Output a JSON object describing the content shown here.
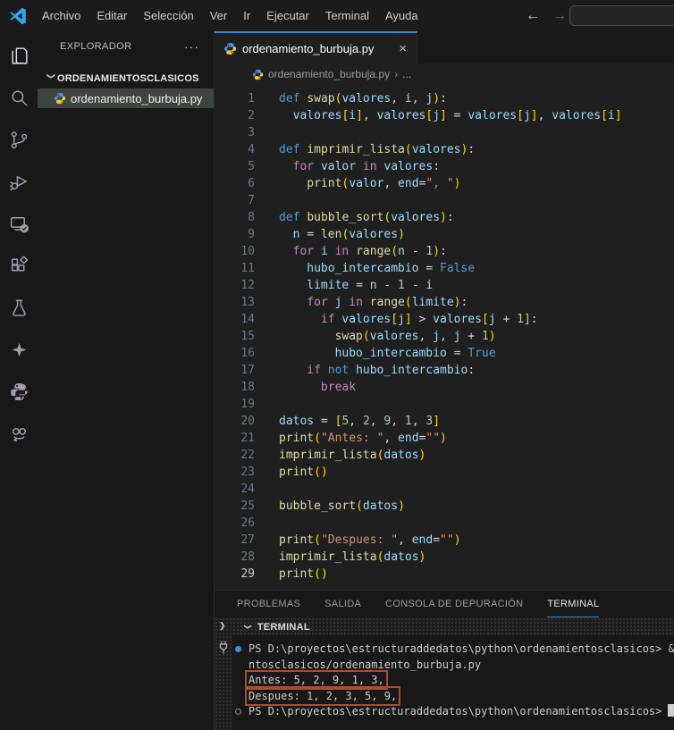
{
  "window": {
    "menu": [
      "Archivo",
      "Editar",
      "Selección",
      "Ver",
      "Ir",
      "Ejecutar",
      "Terminal",
      "Ayuda"
    ],
    "back_arrow": "←",
    "forward_arrow": "→",
    "command_center_value": ""
  },
  "activity_bar": {
    "icons": [
      "explorer",
      "search",
      "source-control",
      "run-and-debug",
      "remote-explorer",
      "extensions",
      "testing",
      "sparkle-ai",
      "python",
      "assistant-robot"
    ]
  },
  "sidebar": {
    "header": "EXPLORADOR",
    "kebab": "···",
    "folder": "ORDENAMIENTOSCLASICOS",
    "files": [
      {
        "name": "ordenamiento_burbuja.py",
        "selected": true
      }
    ]
  },
  "editor": {
    "tab": {
      "label": "ordenamiento_burbuja.py",
      "close": "×"
    },
    "breadcrumb": {
      "file": "ordenamiento_burbuja.py",
      "separator": "›",
      "tail": "..."
    },
    "active_line": 29,
    "lines": [
      {
        "n": 1,
        "i": 0,
        "t": [
          [
            "k",
            "def"
          ],
          [
            "p",
            " "
          ],
          [
            "f",
            "swap"
          ],
          [
            "b",
            "("
          ],
          [
            "v",
            "valores"
          ],
          [
            "p",
            ", "
          ],
          [
            "v",
            "i"
          ],
          [
            "p",
            ", "
          ],
          [
            "v",
            "j"
          ],
          [
            "b",
            ")"
          ],
          [
            "p",
            ":"
          ]
        ]
      },
      {
        "n": 2,
        "i": 1,
        "t": [
          [
            "v",
            "valores"
          ],
          [
            "b",
            "["
          ],
          [
            "v",
            "i"
          ],
          [
            "b",
            "]"
          ],
          [
            "p",
            ", "
          ],
          [
            "v",
            "valores"
          ],
          [
            "b",
            "["
          ],
          [
            "v",
            "j"
          ],
          [
            "b",
            "]"
          ],
          [
            "p",
            " = "
          ],
          [
            "v",
            "valores"
          ],
          [
            "b",
            "["
          ],
          [
            "v",
            "j"
          ],
          [
            "b",
            "]"
          ],
          [
            "p",
            ", "
          ],
          [
            "v",
            "valores"
          ],
          [
            "b",
            "["
          ],
          [
            "v",
            "i"
          ],
          [
            "b",
            "]"
          ]
        ]
      },
      {
        "n": 3,
        "i": 0,
        "t": []
      },
      {
        "n": 4,
        "i": 0,
        "t": [
          [
            "k",
            "def"
          ],
          [
            "p",
            " "
          ],
          [
            "f",
            "imprimir_lista"
          ],
          [
            "b",
            "("
          ],
          [
            "v",
            "valores"
          ],
          [
            "b",
            ")"
          ],
          [
            "p",
            ":"
          ]
        ]
      },
      {
        "n": 5,
        "i": 1,
        "t": [
          [
            "c",
            "for"
          ],
          [
            "p",
            " "
          ],
          [
            "v",
            "valor"
          ],
          [
            "p",
            " "
          ],
          [
            "c",
            "in"
          ],
          [
            "p",
            " "
          ],
          [
            "v",
            "valores"
          ],
          [
            "p",
            ":"
          ]
        ]
      },
      {
        "n": 6,
        "i": 2,
        "t": [
          [
            "f",
            "print"
          ],
          [
            "b",
            "("
          ],
          [
            "v",
            "valor"
          ],
          [
            "p",
            ", "
          ],
          [
            "v",
            "end"
          ],
          [
            "p",
            "="
          ],
          [
            "s",
            "\", \""
          ],
          [
            "b",
            ")"
          ]
        ]
      },
      {
        "n": 7,
        "i": 0,
        "t": []
      },
      {
        "n": 8,
        "i": 0,
        "t": [
          [
            "k",
            "def"
          ],
          [
            "p",
            " "
          ],
          [
            "f",
            "bubble_sort"
          ],
          [
            "b",
            "("
          ],
          [
            "v",
            "valores"
          ],
          [
            "b",
            ")"
          ],
          [
            "p",
            ":"
          ]
        ]
      },
      {
        "n": 9,
        "i": 1,
        "t": [
          [
            "v",
            "n"
          ],
          [
            "p",
            " = "
          ],
          [
            "f",
            "len"
          ],
          [
            "b",
            "("
          ],
          [
            "v",
            "valores"
          ],
          [
            "b",
            ")"
          ]
        ]
      },
      {
        "n": 10,
        "i": 1,
        "t": [
          [
            "c",
            "for"
          ],
          [
            "p",
            " "
          ],
          [
            "v",
            "i"
          ],
          [
            "p",
            " "
          ],
          [
            "c",
            "in"
          ],
          [
            "p",
            " "
          ],
          [
            "f",
            "range"
          ],
          [
            "b",
            "("
          ],
          [
            "v",
            "n"
          ],
          [
            "p",
            " - "
          ],
          [
            "n",
            "1"
          ],
          [
            "b",
            ")"
          ],
          [
            "p",
            ":"
          ]
        ]
      },
      {
        "n": 11,
        "i": 2,
        "t": [
          [
            "v",
            "hubo_intercambio"
          ],
          [
            "p",
            " = "
          ],
          [
            "k",
            "False"
          ]
        ]
      },
      {
        "n": 12,
        "i": 2,
        "t": [
          [
            "v",
            "limite"
          ],
          [
            "p",
            " = "
          ],
          [
            "v",
            "n"
          ],
          [
            "p",
            " - "
          ],
          [
            "n",
            "1"
          ],
          [
            "p",
            " - "
          ],
          [
            "v",
            "i"
          ]
        ]
      },
      {
        "n": 13,
        "i": 2,
        "t": [
          [
            "c",
            "for"
          ],
          [
            "p",
            " "
          ],
          [
            "v",
            "j"
          ],
          [
            "p",
            " "
          ],
          [
            "c",
            "in"
          ],
          [
            "p",
            " "
          ],
          [
            "f",
            "range"
          ],
          [
            "b",
            "("
          ],
          [
            "v",
            "limite"
          ],
          [
            "b",
            ")"
          ],
          [
            "p",
            ":"
          ]
        ]
      },
      {
        "n": 14,
        "i": 3,
        "t": [
          [
            "c",
            "if"
          ],
          [
            "p",
            " "
          ],
          [
            "v",
            "valores"
          ],
          [
            "b",
            "["
          ],
          [
            "v",
            "j"
          ],
          [
            "b",
            "]"
          ],
          [
            "p",
            " > "
          ],
          [
            "v",
            "valores"
          ],
          [
            "b",
            "["
          ],
          [
            "v",
            "j"
          ],
          [
            "p",
            " + "
          ],
          [
            "n",
            "1"
          ],
          [
            "b",
            "]"
          ],
          [
            "p",
            ":"
          ]
        ]
      },
      {
        "n": 15,
        "i": 4,
        "t": [
          [
            "f",
            "swap"
          ],
          [
            "b",
            "("
          ],
          [
            "v",
            "valores"
          ],
          [
            "p",
            ", "
          ],
          [
            "v",
            "j"
          ],
          [
            "p",
            ", "
          ],
          [
            "v",
            "j"
          ],
          [
            "p",
            " + "
          ],
          [
            "n",
            "1"
          ],
          [
            "b",
            ")"
          ]
        ]
      },
      {
        "n": 16,
        "i": 4,
        "t": [
          [
            "v",
            "hubo_intercambio"
          ],
          [
            "p",
            " = "
          ],
          [
            "k",
            "True"
          ]
        ]
      },
      {
        "n": 17,
        "i": 2,
        "t": [
          [
            "c",
            "if"
          ],
          [
            "p",
            " "
          ],
          [
            "k",
            "not"
          ],
          [
            "p",
            " "
          ],
          [
            "v",
            "hubo_intercambio"
          ],
          [
            "p",
            ":"
          ]
        ]
      },
      {
        "n": 18,
        "i": 3,
        "t": [
          [
            "c",
            "break"
          ]
        ]
      },
      {
        "n": 19,
        "i": 0,
        "t": []
      },
      {
        "n": 20,
        "i": 0,
        "t": [
          [
            "v",
            "datos"
          ],
          [
            "p",
            " = "
          ],
          [
            "b",
            "["
          ],
          [
            "n",
            "5"
          ],
          [
            "p",
            ", "
          ],
          [
            "n",
            "2"
          ],
          [
            "p",
            ", "
          ],
          [
            "n",
            "9"
          ],
          [
            "p",
            ", "
          ],
          [
            "n",
            "1"
          ],
          [
            "p",
            ", "
          ],
          [
            "n",
            "3"
          ],
          [
            "b",
            "]"
          ]
        ]
      },
      {
        "n": 21,
        "i": 0,
        "t": [
          [
            "f",
            "print"
          ],
          [
            "b",
            "("
          ],
          [
            "s",
            "\"Antes: \""
          ],
          [
            "p",
            ", "
          ],
          [
            "v",
            "end"
          ],
          [
            "p",
            "="
          ],
          [
            "s",
            "\"\""
          ],
          [
            "b",
            ")"
          ]
        ]
      },
      {
        "n": 22,
        "i": 0,
        "t": [
          [
            "f",
            "imprimir_lista"
          ],
          [
            "b",
            "("
          ],
          [
            "v",
            "datos"
          ],
          [
            "b",
            ")"
          ]
        ]
      },
      {
        "n": 23,
        "i": 0,
        "t": [
          [
            "f",
            "print"
          ],
          [
            "b",
            "()"
          ]
        ]
      },
      {
        "n": 24,
        "i": 0,
        "t": []
      },
      {
        "n": 25,
        "i": 0,
        "t": [
          [
            "f",
            "bubble_sort"
          ],
          [
            "b",
            "("
          ],
          [
            "v",
            "datos"
          ],
          [
            "b",
            ")"
          ]
        ]
      },
      {
        "n": 26,
        "i": 0,
        "t": []
      },
      {
        "n": 27,
        "i": 0,
        "t": [
          [
            "f",
            "print"
          ],
          [
            "b",
            "("
          ],
          [
            "s",
            "\"Despues: \""
          ],
          [
            "p",
            ", "
          ],
          [
            "v",
            "end"
          ],
          [
            "p",
            "="
          ],
          [
            "s",
            "\"\""
          ],
          [
            "b",
            ")"
          ]
        ]
      },
      {
        "n": 28,
        "i": 0,
        "t": [
          [
            "f",
            "imprimir_lista"
          ],
          [
            "b",
            "("
          ],
          [
            "v",
            "datos"
          ],
          [
            "b",
            ")"
          ]
        ]
      },
      {
        "n": 29,
        "i": 0,
        "t": [
          [
            "f",
            "print"
          ],
          [
            "b",
            "()"
          ]
        ]
      }
    ]
  },
  "panel": {
    "tabs": [
      {
        "label": "PROBLEMAS",
        "active": false
      },
      {
        "label": "SALIDA",
        "active": false
      },
      {
        "label": "CONSOLA DE DEPURACIÓN",
        "active": false
      },
      {
        "label": "TERMINAL",
        "active": true
      }
    ],
    "terminal_header": "TERMINAL",
    "terminal_lines": [
      {
        "deco": "filled",
        "text": "PS D:\\proyectos\\estructuraddedatos\\python\\ordenamientosclasicos> &",
        "boxed": false,
        "cursor": false
      },
      {
        "deco": null,
        "text": "ntosclasicos/ordenamiento_burbuja.py",
        "boxed": false,
        "cursor": false
      },
      {
        "deco": null,
        "text": "Antes: 5, 2, 9, 1, 3,",
        "boxed": true,
        "cursor": false
      },
      {
        "deco": null,
        "text": "Despues: 1, 2, 3, 5, 9,",
        "boxed": true,
        "cursor": false
      },
      {
        "deco": "hollow",
        "text": "PS D:\\proyectos\\estructuraddedatos\\python\\ordenamientosclasicos>",
        "boxed": false,
        "cursor": true
      }
    ]
  },
  "colors": {
    "accent_tab_border": "#3b89d8",
    "panel_active_underline": "#3c87d6",
    "annotation_box": "#b04a2a",
    "command_decoration_blue": "#3b8eea",
    "keyword": "#569cd6",
    "control": "#c586c0",
    "function": "#dcdcaa",
    "variable": "#9cdcfe",
    "number": "#b5cea8",
    "string": "#ce9178",
    "bracket": "#ffd700",
    "selection_row": "#3e4540"
  }
}
